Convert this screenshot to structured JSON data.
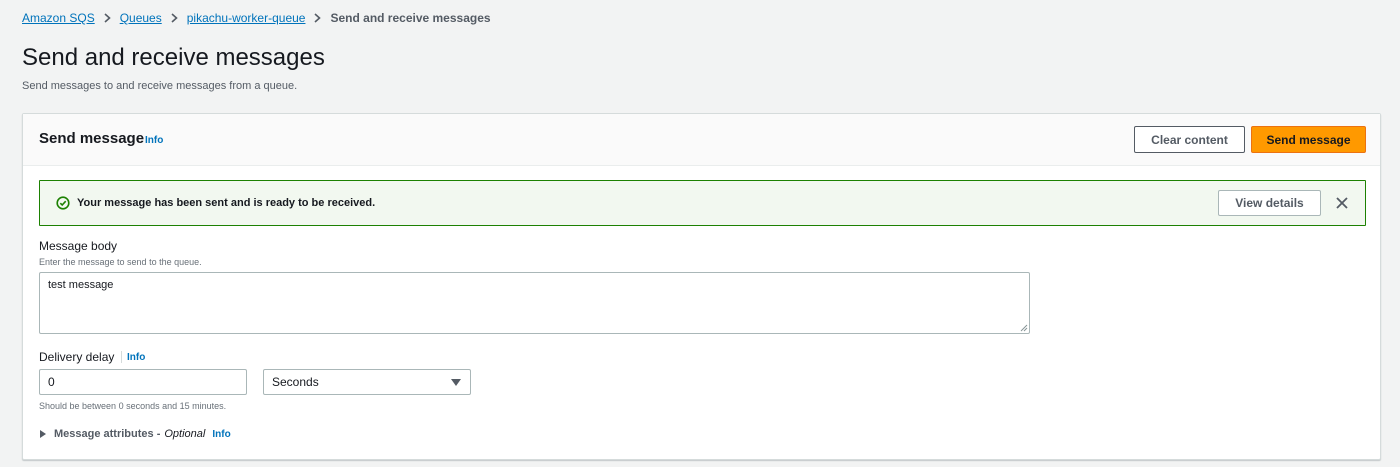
{
  "breadcrumb": {
    "items": [
      "Amazon SQS",
      "Queues",
      "pikachu-worker-queue"
    ],
    "current": "Send and receive messages"
  },
  "page": {
    "title": "Send and receive messages",
    "subtitle": "Send messages to and receive messages from a queue."
  },
  "panel": {
    "title": "Send message",
    "info": "Info",
    "clear_label": "Clear content",
    "send_label": "Send message"
  },
  "flash": {
    "message": "Your message has been sent and is ready to be received.",
    "details_label": "View details",
    "icon": "success-check-circle-icon"
  },
  "message_body": {
    "label": "Message body",
    "description": "Enter the message to send to the queue.",
    "value": "test message"
  },
  "delivery_delay": {
    "label": "Delivery delay",
    "info": "Info",
    "value": "0",
    "unit": "Seconds",
    "constraint": "Should be between 0 seconds and 15 minutes."
  },
  "attributes": {
    "label": "Message attributes -",
    "optional": "Optional",
    "info": "Info"
  },
  "colors": {
    "primary_button": "#ff9900",
    "link": "#0073bb",
    "success": "#1d8102"
  }
}
